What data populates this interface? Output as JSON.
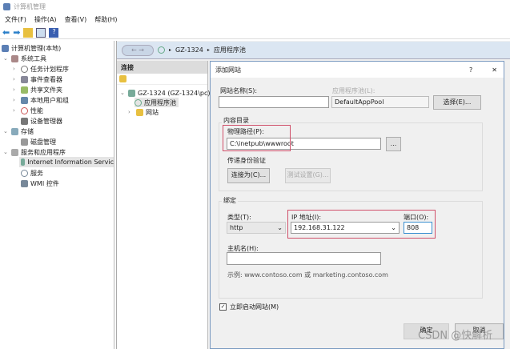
{
  "window": {
    "title": "计算机管理"
  },
  "menu": [
    "文件(F)",
    "操作(A)",
    "查看(V)",
    "帮助(H)"
  ],
  "left_tree": {
    "root": "计算机管理(本地)",
    "system_tools": "系统工具",
    "task_scheduler": "任务计划程序",
    "event_viewer": "事件查看器",
    "shared_folders": "共享文件夹",
    "local_users": "本地用户和组",
    "performance": "性能",
    "device_manager": "设备管理器",
    "storage": "存储",
    "disk_mgmt": "磁盘管理",
    "services_apps": "服务和应用程序",
    "iis": "Internet Information Servic",
    "services": "服务",
    "wmi": "WMI 控件"
  },
  "nav": {
    "back": "←  →",
    "crumbs": [
      "GZ-1324",
      "应用程序池"
    ]
  },
  "connections": {
    "header": "连接",
    "server": "GZ-1324 (GZ-1324\\pc)",
    "app_pools": "应用程序池",
    "sites": "网站"
  },
  "dialog": {
    "title": "添加网站",
    "help": "?",
    "close": "✕",
    "site_name_label": "网站名称(S):",
    "site_name": "",
    "app_pool_label": "应用程序池(L):",
    "app_pool": "DefaultAppPool",
    "select_button": "选择(E)...",
    "content_dir_label": "内容目录",
    "physical_path_label": "物理路径(P):",
    "physical_path": "C:\\inetpub\\wwwroot",
    "browse_button": "...",
    "pass_auth_label": "传递身份验证",
    "connect_as_button": "连接为(C)...",
    "test_settings_button": "测试设置(G)...",
    "binding_label": "绑定",
    "type_label": "类型(T):",
    "type": "http",
    "ip_label": "IP 地址(I):",
    "ip": "192.168.31.122",
    "port_label": "端口(O):",
    "port": "808",
    "host_label": "主机名(H):",
    "host": "",
    "example": "示例: www.contoso.com 或 marketing.contoso.com",
    "start_label": "立即启动网站(M)",
    "start_checked": true,
    "ok_button": "确定",
    "cancel_button": "取消"
  },
  "watermark": "CSDN @快解析"
}
